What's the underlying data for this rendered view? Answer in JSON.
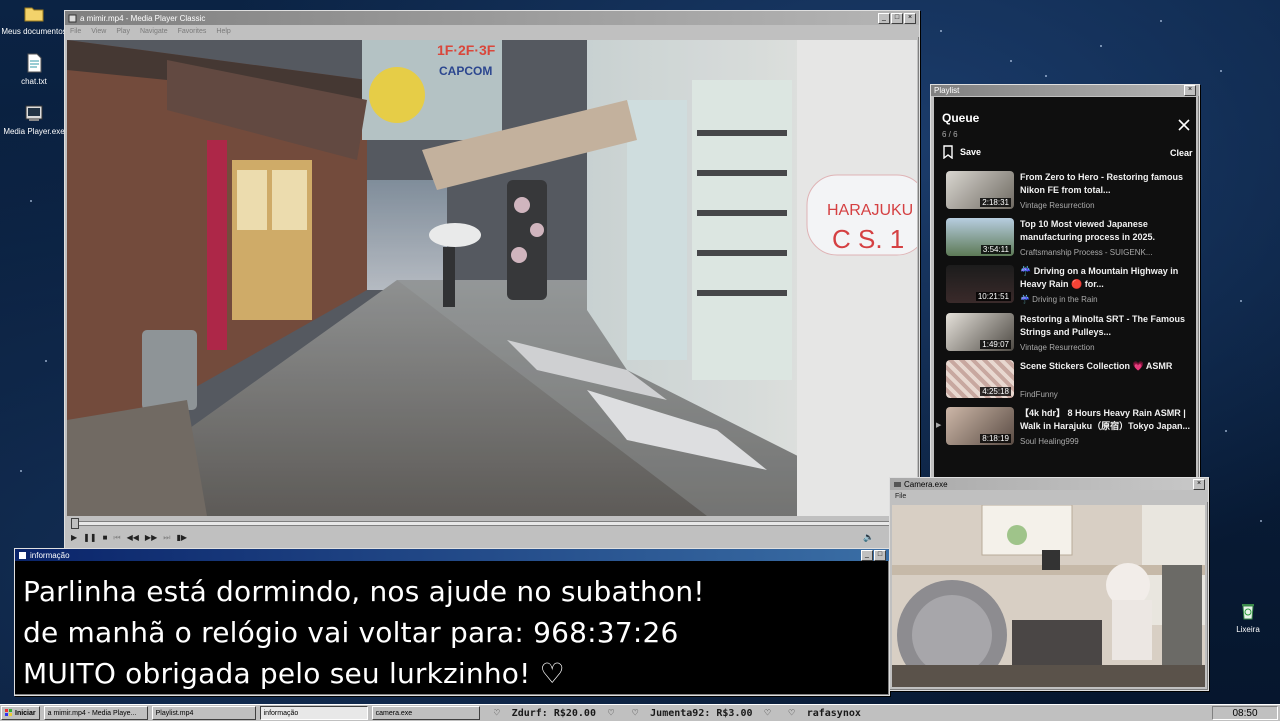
{
  "desktop": {
    "icons": [
      {
        "label": "Meus documentos",
        "icon": "folder-icon"
      },
      {
        "label": "chat.txt",
        "icon": "text-file-icon"
      },
      {
        "label": "Media Player.exe",
        "icon": "executable-icon"
      },
      {
        "label": "Lixeira",
        "icon": "recycle-bin-icon"
      }
    ]
  },
  "player": {
    "title": "a mimir.mp4 - Media Player Classic",
    "menu": [
      "File",
      "View",
      "Play",
      "Navigate",
      "Favorites",
      "Help"
    ],
    "scene_signs": {
      "floors": "1F·2F·3F",
      "brand": "CAPCOM",
      "store_sign_top": "HARAJUKU",
      "store_sign_bottom": "C S. 1"
    }
  },
  "playlist": {
    "window_title": "Playlist",
    "heading": "Queue",
    "count": "6 / 6",
    "save_label": "Save",
    "clear_label": "Clear",
    "items": [
      {
        "title": "From Zero to Hero - Restoring famous Nikon FE from total...",
        "channel": "Vintage Resurrection",
        "duration": "2:18:31"
      },
      {
        "title": "Top 10 Most viewed Japanese manufacturing process in 2025.",
        "channel": "Craftsmanship Process - SUIGENK...",
        "duration": "3:54:11"
      },
      {
        "title": "☔ Driving on a Mountain Highway in Heavy Rain 🔴 for...",
        "channel": "☔ Driving in the Rain",
        "duration": "10:21:51"
      },
      {
        "title": "Restoring a Minolta SRT - The Famous Strings and Pulleys...",
        "channel": "Vintage Resurrection",
        "duration": "1:49:07"
      },
      {
        "title": "Scene Stickers Collection 💗 ASMR",
        "channel": "FindFunny",
        "duration": "4:25:18"
      },
      {
        "title": "【4k hdr】 8 Hours Heavy Rain ASMR | Walk in Harajuku（原宿）Tokyo Japan...",
        "channel": "Soul Healing999",
        "duration": "8:18:19"
      }
    ]
  },
  "info": {
    "title": "informação",
    "line1": "Parlinha está dormindo, nos ajude no subathon!",
    "line2_prefix": "de manhã o relógio vai voltar para:",
    "timer": "968:37:26",
    "line3": "MUITO obrigada pelo seu lurkzinho! ♡"
  },
  "camera": {
    "title": "Camera.exe",
    "menu": "File"
  },
  "taskbar": {
    "start": "Iniciar",
    "tasks": [
      "a mimir.mp4 - Media Playe...",
      "Playlist.mp4",
      "informação",
      "camera.exe"
    ],
    "ticker": "♡  Zdurf: R$20.00  ♡   ♡  Jumenta92: R$3.00  ♡   ♡  rafasynox",
    "clock": "08:50"
  },
  "colors": {
    "desktop": "#071a33",
    "title_active": "#0a246a",
    "playlist_bg": "#0f0f0f",
    "info_text": "#ffffff",
    "ticker_green": "#007a00"
  }
}
